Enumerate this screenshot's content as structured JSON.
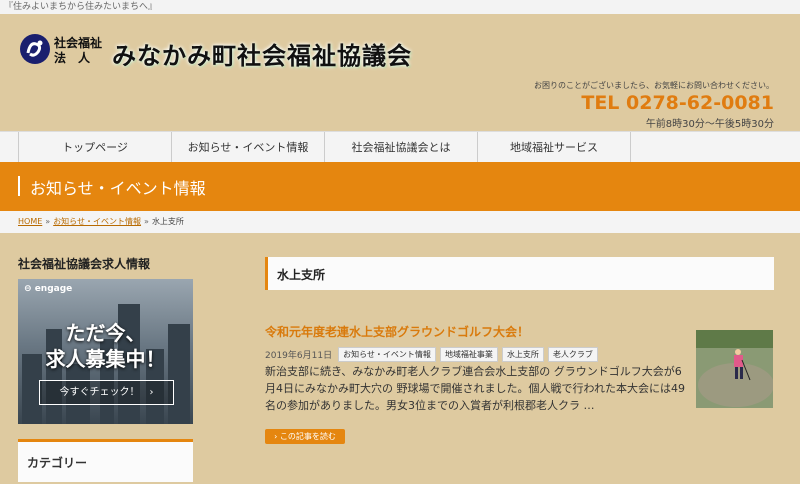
{
  "tagline": "『住みよいまちから住みたいまちへ』",
  "header": {
    "corp_line1": "社会福祉",
    "corp_line2": "法　人",
    "site_title": "みなかみ町社会福祉協議会",
    "contact_msg": "お困りのことがございましたら、お気軽にお問い合わせください。",
    "tel": "TEL 0278-62-0081",
    "hours": "午前8時30分〜午後5時30分"
  },
  "nav": {
    "items": [
      "トップページ",
      "お知らせ・イベント情報",
      "社会福祉協議会とは",
      "地域福祉サービス"
    ]
  },
  "banner": {
    "title": "お知らせ・イベント情報"
  },
  "breadcrumb": {
    "home": "HOME",
    "sep": "»",
    "parent": "お知らせ・イベント情報",
    "current": "水上支所"
  },
  "sidebar": {
    "recruit_heading": "社会福祉協議会求人情報",
    "engage": {
      "logo": "engage",
      "line1": "ただ今、",
      "line2": "求人募集中！",
      "button": "今すぐチェック！　›"
    },
    "category_heading": "カテゴリー"
  },
  "main": {
    "heading": "水上支所",
    "post": {
      "title": "令和元年度老連水上支部グラウンドゴルフ大会！",
      "date": "2019年6月11日",
      "tags": [
        "お知らせ・イベント情報",
        "地域福祉事業",
        "水上支所",
        "老人クラブ"
      ],
      "excerpt": "新治支部に続き、みなかみ町老人クラブ連合会水上支部の グラウンドゴルフ大会が6月4日にみなかみ町大穴の 野球場で開催されました。個人戦で行われた本大会には49名の参加がありました。男女3位までの入賞者が利根郡老人クラ …",
      "more": "› この記事を読む"
    }
  },
  "colors": {
    "accent": "#e5860f",
    "background": "#decaa0",
    "title_orange": "#d97a0c"
  }
}
